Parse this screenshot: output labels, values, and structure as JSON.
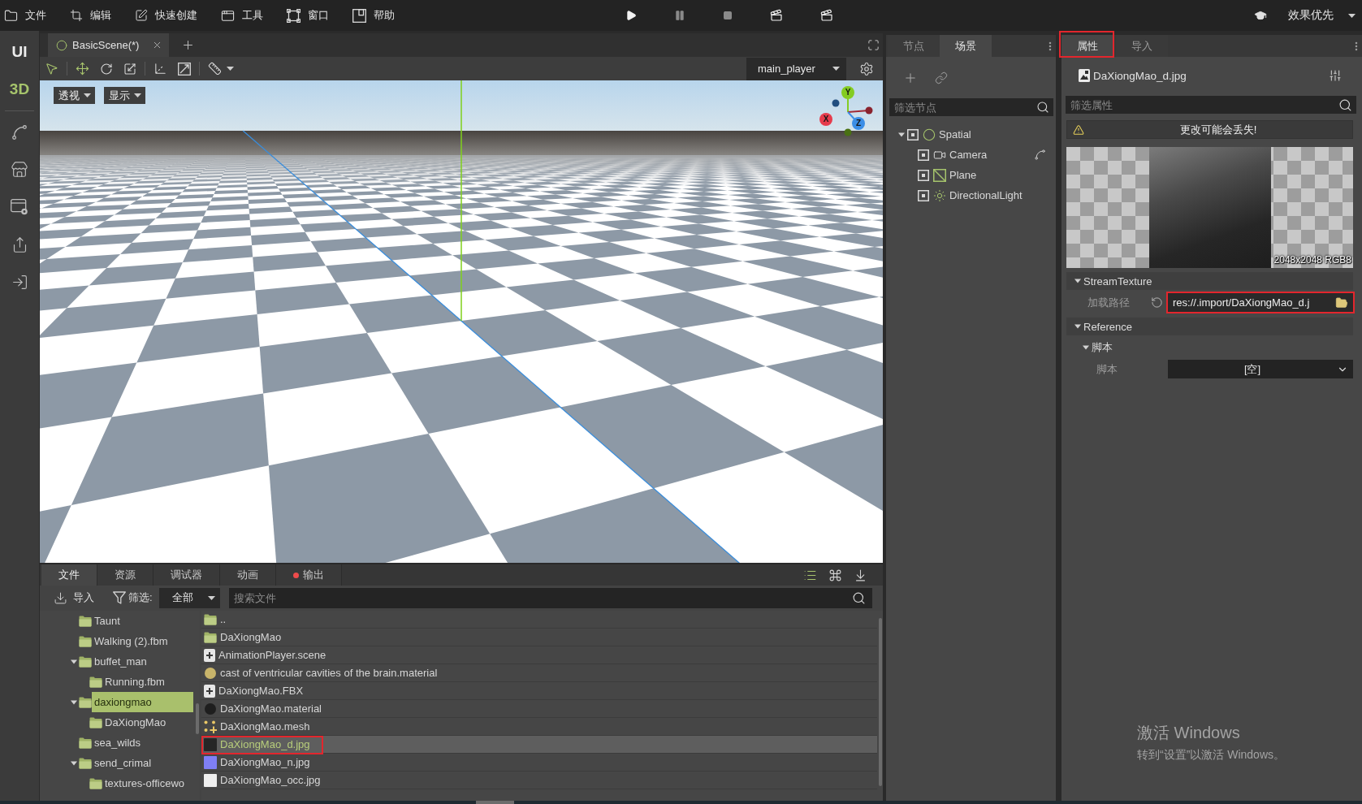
{
  "menu_bar": {
    "menus": [
      {
        "label": "文件"
      },
      {
        "label": "编辑"
      },
      {
        "label": "快速创建"
      },
      {
        "label": "工具"
      },
      {
        "label": "窗口"
      },
      {
        "label": "帮助"
      }
    ],
    "quality": "效果优先"
  },
  "mode_bar": {
    "modes": [
      {
        "label": "UI",
        "selected": false
      },
      {
        "label": "3D",
        "selected": true
      }
    ]
  },
  "editor": {
    "tabs": [
      {
        "label": "BasicScene(*)",
        "selected": true
      }
    ],
    "tools": [
      {
        "selected": true
      },
      {
        "selected": true
      },
      {
        "selected": false
      },
      {
        "selected": false
      },
      {
        "selected": false
      },
      {
        "selected": false
      },
      {
        "selected": false
      }
    ],
    "camera": "main_player",
    "view_menus": [
      "透视",
      "显示"
    ],
    "gizmo_axes": [
      {
        "label": "Y",
        "color": "#84cc22"
      },
      {
        "label": "X",
        "color": "#e63b4c"
      },
      {
        "label": "Z",
        "color": "#3c8ee6"
      }
    ]
  },
  "scene_panel": {
    "tabs": [
      {
        "label": "节点",
        "selected": false
      },
      {
        "label": "场景",
        "selected": true
      }
    ],
    "filter_placeholder": "筛选节点",
    "nodes": [
      {
        "name": "Spatial",
        "kind": "spatial",
        "expanded": true,
        "badge": false,
        "children": [
          {
            "name": "Camera",
            "kind": "camera",
            "badge": true
          },
          {
            "name": "Plane",
            "kind": "plane",
            "badge": false
          },
          {
            "name": "DirectionalLight",
            "kind": "light",
            "badge": false
          }
        ]
      }
    ]
  },
  "inspector": {
    "tabs": [
      {
        "label": "属性",
        "selected": true,
        "annotated": true
      },
      {
        "label": "导入",
        "selected": false,
        "annotated": false
      }
    ],
    "resource": "DaXiongMao_d.jpg",
    "filter_placeholder": "筛选属性",
    "warning": "更改可能会丢失!",
    "preview_caption": "2048x2048 RGB8",
    "sections": [
      {
        "title": "StreamTexture",
        "expanded": true,
        "rows": [
          {
            "kind": "path",
            "label": "加载路径",
            "value": "res://.import/DaXiongMao_d.j",
            "annotated": true
          }
        ]
      },
      {
        "title": "Reference",
        "expanded": true,
        "groups": [
          {
            "title": "脚本",
            "expanded": true,
            "rows": [
              {
                "kind": "select",
                "label": "脚本",
                "value": "[空]",
                "annotated": false
              }
            ]
          }
        ]
      }
    ]
  },
  "filesystem": {
    "tabs": [
      {
        "label": "文件",
        "selected": true,
        "alert": false
      },
      {
        "label": "资源",
        "selected": false,
        "alert": false
      },
      {
        "label": "调试器",
        "selected": false,
        "alert": false
      },
      {
        "label": "动画",
        "selected": false,
        "alert": false
      },
      {
        "label": "输出",
        "selected": false,
        "alert": true
      }
    ],
    "view_modes": [
      {
        "selected": true
      },
      {
        "selected": false
      }
    ],
    "import_label": "导入",
    "filter_label": "筛选:",
    "filter_value": "全部",
    "search_placeholder": "搜索文件",
    "folders": [
      {
        "name": "Taunt",
        "selected": false
      },
      {
        "name": "Walking (2).fbm",
        "selected": false
      },
      {
        "name": "buffet_man",
        "selected": false,
        "expanded": true,
        "children": [
          {
            "name": "Running.fbm",
            "selected": false
          }
        ]
      },
      {
        "name": "daxiongmao",
        "selected": true,
        "expanded": true,
        "children": [
          {
            "name": "DaXiongMao",
            "selected": false
          }
        ]
      },
      {
        "name": "sea_wilds",
        "selected": false
      },
      {
        "name": "send_crimal",
        "selected": false,
        "expanded": true,
        "children": [
          {
            "name": "textures-officewo",
            "selected": false
          }
        ]
      }
    ],
    "files": [
      {
        "name": "..",
        "kind": "folder",
        "selected": false,
        "annotated": false
      },
      {
        "name": "DaXiongMao",
        "kind": "folder",
        "selected": false,
        "annotated": false
      },
      {
        "name": "AnimationPlayer.scene",
        "kind": "scene",
        "selected": false,
        "annotated": false
      },
      {
        "name": "cast of ventricular cavities of the brain.material",
        "kind": "material",
        "color": "#c8b46a",
        "selected": false,
        "annotated": false
      },
      {
        "name": "DaXiongMao.FBX",
        "kind": "model",
        "selected": false,
        "annotated": false
      },
      {
        "name": "DaXiongMao.material",
        "kind": "material",
        "color": "#1e1e1e",
        "selected": false,
        "annotated": false
      },
      {
        "name": "DaXiongMao.mesh",
        "kind": "mesh",
        "selected": false,
        "annotated": false
      },
      {
        "name": "DaXiongMao_d.jpg",
        "kind": "image",
        "color": "#262626",
        "selected": true,
        "annotated": true
      },
      {
        "name": "DaXiongMao_n.jpg",
        "kind": "image",
        "color": "#7f7ff5",
        "selected": false,
        "annotated": false
      },
      {
        "name": "DaXiongMao_occ.jpg",
        "kind": "image",
        "color": "#eeeeee",
        "selected": false,
        "annotated": false
      }
    ]
  },
  "os_notice": {
    "title": "激活 Windows",
    "hint": "转到“设置”以激活 Windows。"
  }
}
